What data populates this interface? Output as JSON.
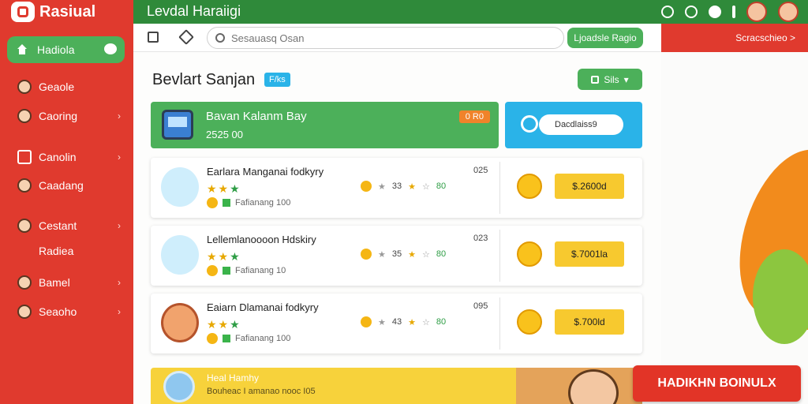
{
  "app": {
    "logo_text": "Rasiual"
  },
  "topbar": {
    "title": "Levdal Haraiigi"
  },
  "address": {
    "search_placeholder": "Sesauasq Osan",
    "action_label": "Ljoadsle Ragio",
    "right_link": "Scracschieo >"
  },
  "sidebar": {
    "items": [
      {
        "label": "Hadiola",
        "icon": "home-icon",
        "active": true
      },
      {
        "label": "Geaole",
        "icon": "avatar-icon"
      },
      {
        "label": "Caoring",
        "icon": "avatar-icon",
        "chevron": true
      },
      {
        "label": "Canolin",
        "icon": "box-icon",
        "chevron": true
      },
      {
        "label": "Caadang",
        "icon": "avatar-icon"
      },
      {
        "label": "Cestant",
        "icon": "avatar-icon",
        "chevron": true
      },
      {
        "label": "Radiea",
        "icon": "",
        "sub": true
      },
      {
        "label": "Bamel",
        "icon": "avatar-icon",
        "chevron": true
      },
      {
        "label": "Seaoho",
        "icon": "avatar-icon",
        "chevron": true
      }
    ]
  },
  "main": {
    "title": "Bevlart Sanjan",
    "title_badge": "F/ks",
    "filter_label": "Sils",
    "banner": {
      "title": "Bavan Kalanm Bay",
      "subtitle": "2525 00",
      "tag": "0 R0"
    },
    "blue_box": {
      "label": "Dacdlaiss9"
    },
    "cards": [
      {
        "title": "Earlara Manganai fodkyry",
        "meta": "Fafianang 100",
        "mid_a": "33",
        "mid_b": "80",
        "number": "025",
        "price": "$.2600d",
        "thumb": "books"
      },
      {
        "title": "Lellemlanoooon Hdskiry",
        "meta": "Fafianang 10",
        "mid_a": "35",
        "mid_b": "80",
        "number": "023",
        "price": "$.7001la",
        "thumb": "box"
      },
      {
        "title": "Eaiarn Dlamanai fodkyry",
        "meta": "Fafianang 100",
        "mid_a": "43",
        "mid_b": "80",
        "number": "095",
        "price": "$.700ld",
        "thumb": "person"
      }
    ],
    "bottom": {
      "title": "Heal Hamhy",
      "subtitle": "Bouheac I amanao nooc I05"
    }
  },
  "cta": {
    "label": "HADIKHN BOINULX"
  },
  "colors": {
    "sidebar": "#e03a2e",
    "topbar": "#2f8a3a",
    "accent_green": "#4cb05a",
    "accent_blue": "#2ab3e8",
    "price_yellow": "#f7c92f"
  }
}
